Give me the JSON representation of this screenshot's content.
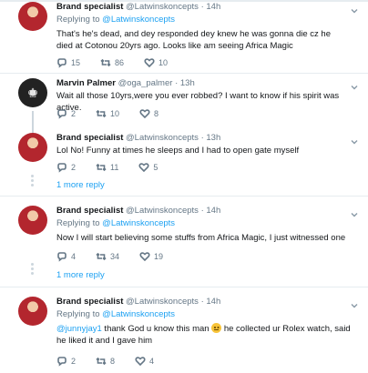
{
  "tweets": [
    {
      "name": "Brand specialist",
      "handle": "@Latwinskoncepts",
      "time": "14h",
      "replying_label": "Replying to",
      "replying_to": "@Latwinskoncepts",
      "text": "That's he's dead, and dey responded dey knew he was gonna die cz he died at Cotonou 20yrs ago. Looks like am seeing Africa Magic",
      "replies": "15",
      "retweets": "86",
      "likes": "10"
    },
    {
      "name": "Marvin Palmer",
      "handle": "@oga_palmer",
      "time": "13h",
      "text": "Wait all those 10yrs,were you ever robbed? I want to know if his spirit was active.",
      "replies": "2",
      "retweets": "10",
      "likes": "8"
    },
    {
      "name": "Brand specialist",
      "handle": "@Latwinskoncepts",
      "time": "13h",
      "text": "Lol No! Funny at times he sleeps and I had to open gate myself",
      "replies": "2",
      "retweets": "11",
      "likes": "5",
      "more": "1 more reply"
    },
    {
      "name": "Brand specialist",
      "handle": "@Latwinskoncepts",
      "time": "14h",
      "replying_label": "Replying to",
      "replying_to": "@Latwinskoncepts",
      "text": "Now I will start believing some stuffs from Africa Magic, I just witnessed one",
      "replies": "4",
      "retweets": "34",
      "likes": "19",
      "more": "1 more reply"
    },
    {
      "name": "Brand specialist",
      "handle": "@Latwinskoncepts",
      "time": "14h",
      "replying_label": "Replying to",
      "replying_to": "@Latwinskoncepts",
      "text_mention": "@junnyjay1",
      "text_part1": " thank God u know this man ",
      "text_part2": " he collected ur Rolex watch, said he liked it and I gave him",
      "replies": "2",
      "retweets": "8",
      "likes": "4"
    }
  ],
  "separator": "·",
  "icons": {
    "reply": "reply-icon",
    "retweet": "retweet-icon",
    "like": "heart-icon",
    "caret": "chevron-down-icon",
    "emoji": "smiling-face-emoji"
  },
  "colors": {
    "link": "#1da1f2",
    "muted": "#657786",
    "text": "#14171a",
    "divider": "#e6ecf0"
  }
}
